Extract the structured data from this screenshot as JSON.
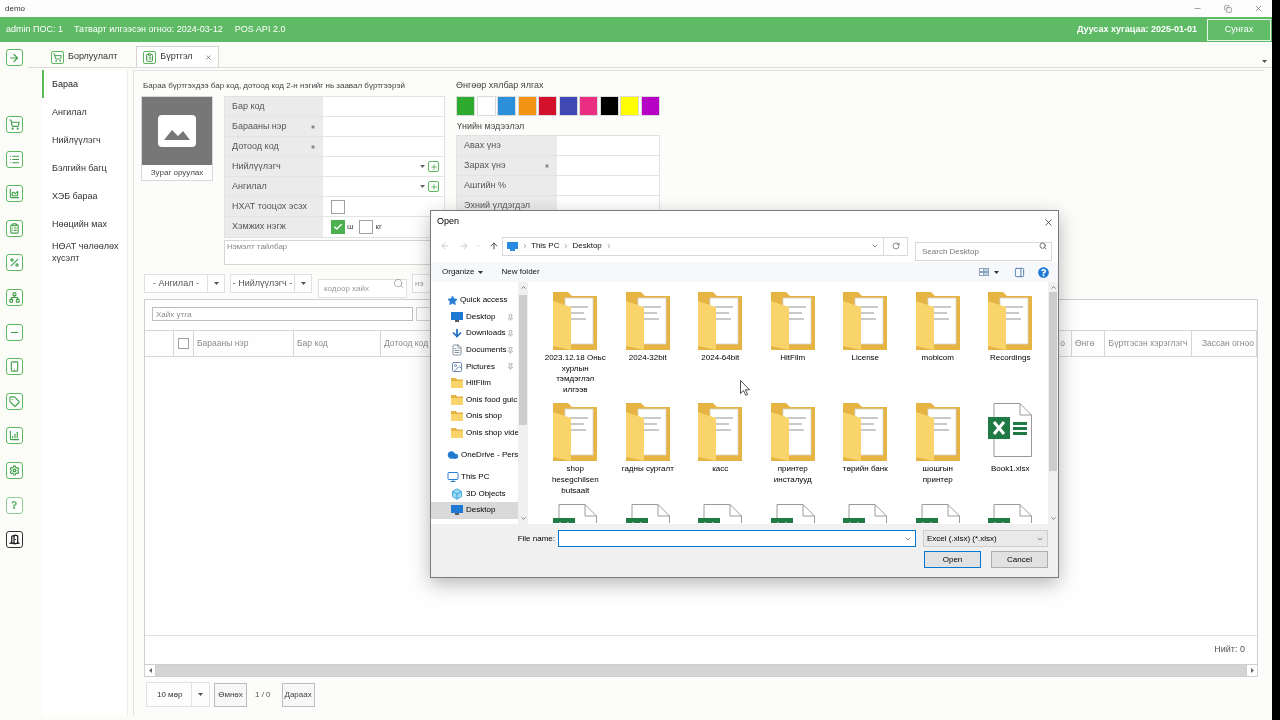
{
  "window": {
    "title": "demo"
  },
  "header": {
    "user": "admin ПОС: 1",
    "tax_date": "Татварт илгээсэн огноо: 2024-03-12",
    "api": "POS API 2.0",
    "expiry": "Дуусах хугацаа: 2025-01-01",
    "renew_button": "Сунгах"
  },
  "tabs": [
    {
      "label": "Борлуулалт",
      "selected": false,
      "closable": false
    },
    {
      "label": "Бүртгэл",
      "selected": true,
      "closable": true
    }
  ],
  "sidebar": {
    "items": [
      {
        "label": "Бараа",
        "selected": true
      },
      {
        "label": "Ангилал",
        "selected": false
      },
      {
        "label": "Нийлүүлэгч",
        "selected": false
      },
      {
        "label": "Бэлгийн багц",
        "selected": false
      },
      {
        "label": "ХЭБ бараа",
        "selected": false
      },
      {
        "label": "Нөөцийн мах",
        "selected": false
      },
      {
        "label": "НӨАТ чөлөөлөх хүсэлт",
        "selected": false
      }
    ]
  },
  "product_form": {
    "note": "Бараа бүртгэхдээ бар код, дотоод код 2-н нэгийг нь заавал бүртгээрэй",
    "image_button": "Зураг оруулах",
    "fields": [
      {
        "label": "Бар код",
        "kind": "text",
        "required": false
      },
      {
        "label": "Барааны нэр",
        "kind": "text",
        "required": true
      },
      {
        "label": "Дотоод код",
        "kind": "text",
        "required": true
      },
      {
        "label": "Нийлүүлэгч",
        "kind": "select",
        "required": false
      },
      {
        "label": "Ангилал",
        "kind": "select",
        "required": false
      },
      {
        "label": "НХАТ тооцох эсэх",
        "kind": "checkbox",
        "required": false,
        "checked": false
      },
      {
        "label": "Хэмжих нэгж",
        "kind": "units",
        "required": false,
        "options": [
          {
            "label": "ш",
            "checked": true
          },
          {
            "label": "кг",
            "checked": false
          }
        ]
      }
    ],
    "description": {
      "placeholder": "Нэмэлт тайлбар"
    }
  },
  "colors": {
    "title": "Өнгөөр хялбар ялгах",
    "swatches": [
      {
        "color": "#2eaa2e"
      },
      {
        "color": "#ffffff"
      },
      {
        "color": "#2b90d9"
      },
      {
        "color": "#f39314"
      },
      {
        "color": "#d3112c"
      },
      {
        "color": "#3f48b3"
      },
      {
        "color": "#ea2f82"
      },
      {
        "color": "#000000"
      },
      {
        "color": "#ffff00"
      },
      {
        "color": "#b600c6"
      }
    ]
  },
  "price_info": {
    "title": "Үнийн мэдээлэл",
    "fields": [
      {
        "label": "Авах үнэ",
        "required": false
      },
      {
        "label": "Зарах үнэ",
        "required": true
      },
      {
        "label": "Ашгийн %",
        "required": false
      },
      {
        "label": "Эхний үлдэгдэл",
        "required": false
      }
    ]
  },
  "filters": {
    "category": "- Ангилал -",
    "supplier": "- Нийлүүлэгч -",
    "code_search": {
      "placeholder": "кодоор хайх"
    },
    "name_search": {
      "placeholder": "нэ"
    }
  },
  "grid": {
    "search": {
      "placeholder": "Хайх утга"
    },
    "select_all": {
      "checked": false
    },
    "columns": [
      {
        "label": "Барааны нэр"
      },
      {
        "label": "Бар код"
      },
      {
        "label": "Дотоод код"
      },
      {
        "label": "о"
      },
      {
        "label": "Өнгө"
      },
      {
        "label": "Бүртгэсэн хэрэглэгч"
      },
      {
        "label": "Зассан огноо"
      }
    ],
    "total": "Нийт: 0"
  },
  "pagination": {
    "page_size": "10 мөр",
    "prev": "Өмнөх",
    "page": "1 / 0",
    "next": "Дараах"
  },
  "dialog": {
    "title": "Open",
    "path": [
      "This PC",
      "Desktop"
    ],
    "search": {
      "placeholder": "Search Desktop"
    },
    "organize": "Organize",
    "new_folder": "New folder",
    "nav": [
      {
        "label": "Quick access",
        "kind": "quick_access",
        "selected": false,
        "children": [
          {
            "label": "Desktop",
            "kind": "desktop",
            "pinned": true,
            "selected": false
          },
          {
            "label": "Downloads",
            "kind": "downloads",
            "pinned": true,
            "selected": false
          },
          {
            "label": "Documents",
            "kind": "documents",
            "pinned": true,
            "selected": false
          },
          {
            "label": "Pictures",
            "kind": "pictures",
            "pinned": true,
            "selected": false
          },
          {
            "label": "HitFilm",
            "kind": "folder",
            "pinned": false,
            "selected": false
          },
          {
            "label": "Onis food guic",
            "kind": "folder",
            "pinned": false,
            "selected": false
          },
          {
            "label": "Onis shop",
            "kind": "folder",
            "pinned": false,
            "selected": false
          },
          {
            "label": "Onis shop vide",
            "kind": "folder",
            "pinned": false,
            "selected": false
          }
        ]
      },
      {
        "label": "OneDrive - Pers",
        "kind": "onedrive",
        "selected": false
      },
      {
        "label": "This PC",
        "kind": "this_pc",
        "selected": false,
        "children": [
          {
            "label": "3D Objects",
            "kind": "objects_3d",
            "pinned": false,
            "selected": false
          },
          {
            "label": "Desktop",
            "kind": "desktop",
            "pinned": false,
            "selected": true
          }
        ]
      }
    ],
    "items": [
      {
        "name": "2023.12.18 Оньс хурлын тэмдэглэл илгээв",
        "kind": "folder",
        "clipped": false
      },
      {
        "name": "2024-32bit",
        "kind": "folder",
        "clipped": false
      },
      {
        "name": "2024-64bit",
        "kind": "folder",
        "clipped": false
      },
      {
        "name": "HitFilm",
        "kind": "folder",
        "clipped": false
      },
      {
        "name": "License",
        "kind": "folder",
        "clipped": false
      },
      {
        "name": "mobicom",
        "kind": "folder",
        "clipped": false
      },
      {
        "name": "Recordings",
        "kind": "folder",
        "clipped": false
      },
      {
        "name": "shop hesegchilsen butsaalt",
        "kind": "folder",
        "clipped": false
      },
      {
        "name": "гадны сургалт",
        "kind": "folder",
        "clipped": false
      },
      {
        "name": "касс",
        "kind": "folder",
        "clipped": false
      },
      {
        "name": "принтер инсталууд",
        "kind": "folder",
        "clipped": false
      },
      {
        "name": "төрийн банк",
        "kind": "folder",
        "clipped": false
      },
      {
        "name": "шошгын принтер",
        "kind": "folder",
        "clipped": false
      },
      {
        "name": "Book1.xlsx",
        "kind": "spreadsheet",
        "clipped": false
      },
      {
        "kind": "spreadsheet",
        "clipped": true
      },
      {
        "kind": "spreadsheet",
        "clipped": true
      },
      {
        "kind": "spreadsheet",
        "clipped": true
      },
      {
        "kind": "spreadsheet",
        "clipped": true
      },
      {
        "kind": "spreadsheet",
        "clipped": true
      },
      {
        "kind": "spreadsheet",
        "clipped": true
      },
      {
        "kind": "spreadsheet",
        "clipped": true
      }
    ],
    "file_name_label": "File name:",
    "file_type": "Excel (.xlsx) (*.xlsx)",
    "buttons": [
      {
        "label": "Open",
        "default": true
      },
      {
        "label": "Cancel",
        "default": false
      }
    ]
  }
}
